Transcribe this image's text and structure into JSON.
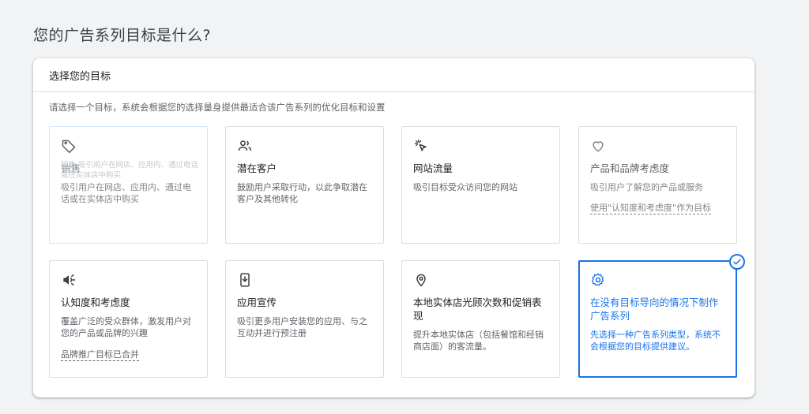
{
  "page": {
    "title": "您的广告系列目标是什么?"
  },
  "panel": {
    "header": "选择您的目标",
    "description": "请选择一个目标，系统会根据您的选择量身提供最适合该广告系列的优化目标和设置"
  },
  "cards": [
    {
      "icon": "tag-icon",
      "title": "销售",
      "desc": "吸引用户在网店、应用内、通过电话或在实体店中购买",
      "ghost": "销售 吸引用户在网店、应用内、通过电话或在实体店中购买",
      "link": "",
      "state": "faded"
    },
    {
      "icon": "people-icon",
      "title": "潜在客户",
      "desc": "鼓励用户采取行动，以此争取潜在客户及其他转化",
      "link": "",
      "state": "normal"
    },
    {
      "icon": "cursor-click-icon",
      "title": "网站流量",
      "desc": "吸引目标受众访问您的网站",
      "link": "",
      "state": "normal"
    },
    {
      "icon": "heart-icon",
      "title": "产品和品牌考虑度",
      "desc": "吸引用户了解您的产品或服务",
      "link": "使用\"认知度和考虑度\"作为目标",
      "state": "normal"
    },
    {
      "icon": "megaphone-icon",
      "title": "认知度和考虑度",
      "desc": "覆盖广泛的受众群体，激发用户对您的产品或品牌的兴趣",
      "link": "品牌推广目标已合并",
      "state": "normal"
    },
    {
      "icon": "phone-download-icon",
      "title": "应用宣传",
      "desc": "吸引更多用户安装您的应用、与之互动并进行预注册",
      "link": "",
      "state": "normal"
    },
    {
      "icon": "location-pin-icon",
      "title": "本地实体店光顾次数和促销表现",
      "desc": "提升本地实体店（包括餐馆和经销商店面）的客流量。",
      "link": "",
      "state": "normal"
    },
    {
      "icon": "gear-icon",
      "title": "在没有目标导向的情况下制作广告系列",
      "desc": "先选择一种广告系列类型，系统不会根据您的目标提供建议。",
      "link": "",
      "state": "selected"
    }
  ],
  "colors": {
    "accent": "#1a73e8",
    "border": "#dadce0",
    "text_secondary": "#5f6368"
  }
}
